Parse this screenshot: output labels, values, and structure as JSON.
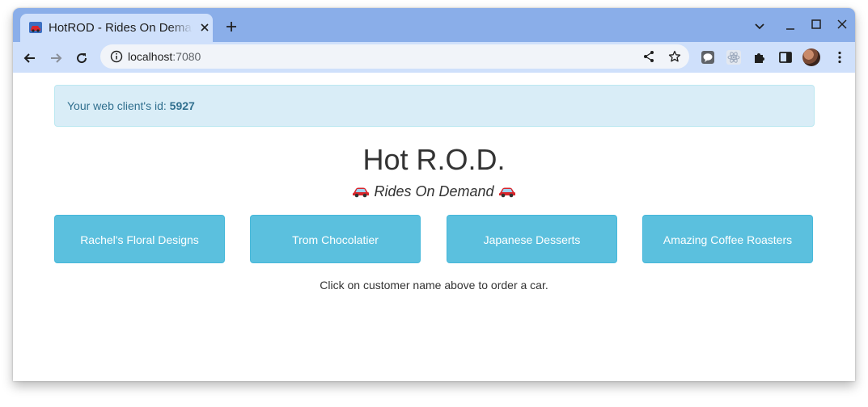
{
  "browser": {
    "tab_title": "HotROD - Rides On Demand",
    "url_host": "localhost",
    "url_port": ":7080",
    "accent_color": "#8aaee9"
  },
  "alert": {
    "prefix": "Your web client's id: ",
    "client_id": "5927"
  },
  "page": {
    "title": "Hot R.O.D.",
    "subtitle": "Rides On Demand",
    "hint": "Click on customer name above to order a car."
  },
  "customers": [
    {
      "label": "Rachel's Floral Designs"
    },
    {
      "label": "Trom Chocolatier"
    },
    {
      "label": "Japanese Desserts"
    },
    {
      "label": "Amazing Coffee Roasters"
    }
  ],
  "icons": {
    "favicon": "car-icon",
    "subtitle_decoration": "car-icon"
  },
  "colors": {
    "button_bg": "#5bc0de",
    "alert_bg": "#d9edf7",
    "alert_text": "#31708f"
  }
}
